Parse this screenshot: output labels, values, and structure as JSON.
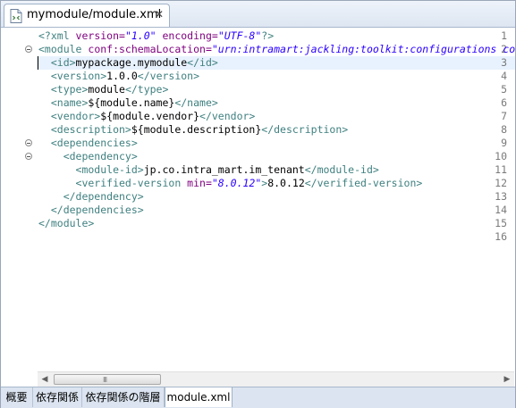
{
  "editor_tab": {
    "title": "mymodule/module.xml",
    "close_glyph": "✕",
    "icon": "xml-file-icon"
  },
  "colors": {
    "tag": "#3f7f7f",
    "attr": "#7f007f",
    "value": "#2a00ff",
    "current_line": "#e8f2fe"
  },
  "lines": [
    {
      "n": "1",
      "segs": [
        {
          "t": "<?xml ",
          "c": "pi"
        },
        {
          "t": "version=",
          "c": "attr"
        },
        {
          "t": "\"1.0\"",
          "c": "val"
        },
        {
          "t": " encoding=",
          "c": "attr"
        },
        {
          "t": "\"UTF-8\"",
          "c": "val"
        },
        {
          "t": "?>",
          "c": "pi"
        }
      ]
    },
    {
      "n": "2",
      "fold": true,
      "segs": [
        {
          "t": "<module ",
          "c": "tag"
        },
        {
          "t": "conf:schemaLocation=",
          "c": "attr"
        },
        {
          "t": "\"urn:intramart:jackling:toolkit:configurations co",
          "c": "val"
        }
      ]
    },
    {
      "n": "3",
      "current": true,
      "segs": [
        {
          "t": "  <id>",
          "c": "tag"
        },
        {
          "t": "mypackage.mymodule",
          "c": "txt"
        },
        {
          "t": "</id>",
          "c": "tag"
        }
      ]
    },
    {
      "n": "4",
      "segs": [
        {
          "t": "  <version>",
          "c": "tag"
        },
        {
          "t": "1.0.0",
          "c": "txt"
        },
        {
          "t": "</version>",
          "c": "tag"
        }
      ]
    },
    {
      "n": "5",
      "segs": [
        {
          "t": "  <type>",
          "c": "tag"
        },
        {
          "t": "module",
          "c": "txt"
        },
        {
          "t": "</type>",
          "c": "tag"
        }
      ]
    },
    {
      "n": "6",
      "segs": [
        {
          "t": "  <name>",
          "c": "tag"
        },
        {
          "t": "${module.name}",
          "c": "txt"
        },
        {
          "t": "</name>",
          "c": "tag"
        }
      ]
    },
    {
      "n": "7",
      "segs": [
        {
          "t": "  <vendor>",
          "c": "tag"
        },
        {
          "t": "${module.vendor}",
          "c": "txt"
        },
        {
          "t": "</vendor>",
          "c": "tag"
        }
      ]
    },
    {
      "n": "8",
      "segs": [
        {
          "t": "  <description>",
          "c": "tag"
        },
        {
          "t": "${module.description}",
          "c": "txt"
        },
        {
          "t": "</description>",
          "c": "tag"
        }
      ]
    },
    {
      "n": "9",
      "fold": true,
      "segs": [
        {
          "t": "  <dependencies>",
          "c": "tag"
        }
      ]
    },
    {
      "n": "10",
      "fold": true,
      "segs": [
        {
          "t": "    <dependency>",
          "c": "tag"
        }
      ]
    },
    {
      "n": "11",
      "segs": [
        {
          "t": "      <module-id>",
          "c": "tag"
        },
        {
          "t": "jp.co.intra_mart.im_tenant",
          "c": "txt"
        },
        {
          "t": "</module-id>",
          "c": "tag"
        }
      ]
    },
    {
      "n": "12",
      "segs": [
        {
          "t": "      <verified-version ",
          "c": "tag"
        },
        {
          "t": "min=",
          "c": "attr"
        },
        {
          "t": "\"8.0.12\"",
          "c": "val"
        },
        {
          "t": ">",
          "c": "tag"
        },
        {
          "t": "8.0.12",
          "c": "txt"
        },
        {
          "t": "</verified-version>",
          "c": "tag"
        }
      ]
    },
    {
      "n": "13",
      "segs": [
        {
          "t": "    </dependency>",
          "c": "tag"
        }
      ]
    },
    {
      "n": "14",
      "segs": [
        {
          "t": "  </dependencies>",
          "c": "tag"
        }
      ]
    },
    {
      "n": "15",
      "segs": [
        {
          "t": "</module>",
          "c": "tag"
        }
      ]
    },
    {
      "n": "16",
      "segs": []
    }
  ],
  "scrollbar": {
    "left_arrow": "◀",
    "right_arrow": "▶",
    "grip": "III"
  },
  "bottom_tabs": [
    {
      "label": "概要"
    },
    {
      "label": "依存関係"
    },
    {
      "label": "依存関係の階層"
    },
    {
      "label": "module.xml",
      "active": true
    }
  ]
}
